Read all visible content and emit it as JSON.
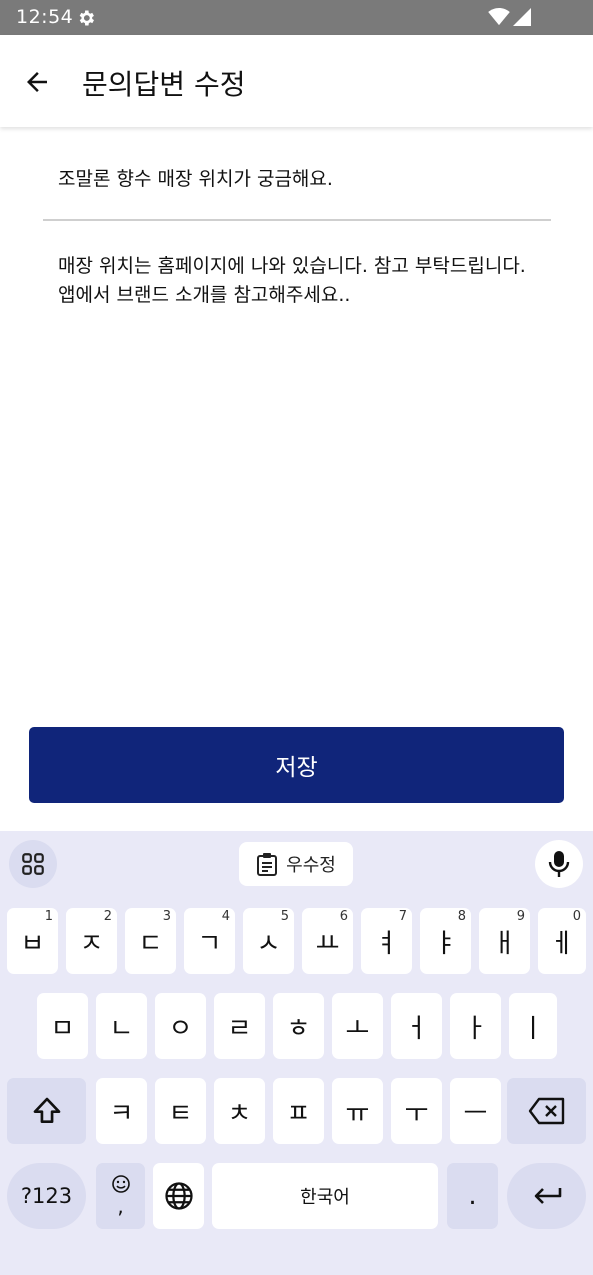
{
  "status_bar": {
    "time": "12:54",
    "icons": [
      "gear-icon",
      "wifi-icon",
      "cell-signal-icon"
    ]
  },
  "app_bar": {
    "title": "문의답변 수정",
    "back_icon": "arrow-left-icon"
  },
  "form": {
    "question": "조말론 향수 매장 위치가 궁금해요.",
    "answer": "매장 위치는 홈페이지에 나와 있습니다. 참고 부탁드립니다. 앱에서 브랜드 소개를 참고해주세요.."
  },
  "save_button": {
    "label": "저장",
    "color": "#10257a"
  },
  "keyboard": {
    "suggestion_chip": "우수정",
    "row1": [
      {
        "char": "ㅂ",
        "num": "1"
      },
      {
        "char": "ㅈ",
        "num": "2"
      },
      {
        "char": "ㄷ",
        "num": "3"
      },
      {
        "char": "ㄱ",
        "num": "4"
      },
      {
        "char": "ㅅ",
        "num": "5"
      },
      {
        "char": "ㅛ",
        "num": "6"
      },
      {
        "char": "ㅕ",
        "num": "7"
      },
      {
        "char": "ㅑ",
        "num": "8"
      },
      {
        "char": "ㅐ",
        "num": "9"
      },
      {
        "char": "ㅔ",
        "num": "0"
      }
    ],
    "row2": [
      "ㅁ",
      "ㄴ",
      "ㅇ",
      "ㄹ",
      "ㅎ",
      "ㅗ",
      "ㅓ",
      "ㅏ",
      "ㅣ"
    ],
    "row3": [
      "ㅋ",
      "ㅌ",
      "ㅊ",
      "ㅍ",
      "ㅠ",
      "ㅜ",
      "ㅡ"
    ],
    "symbols_key": "?123",
    "emoji_key_comma": ",",
    "space_key": "한국어",
    "period_key": ".",
    "keyboard_bg": "#e9e9f7",
    "modifier_key_bg": "#dadcf0"
  }
}
